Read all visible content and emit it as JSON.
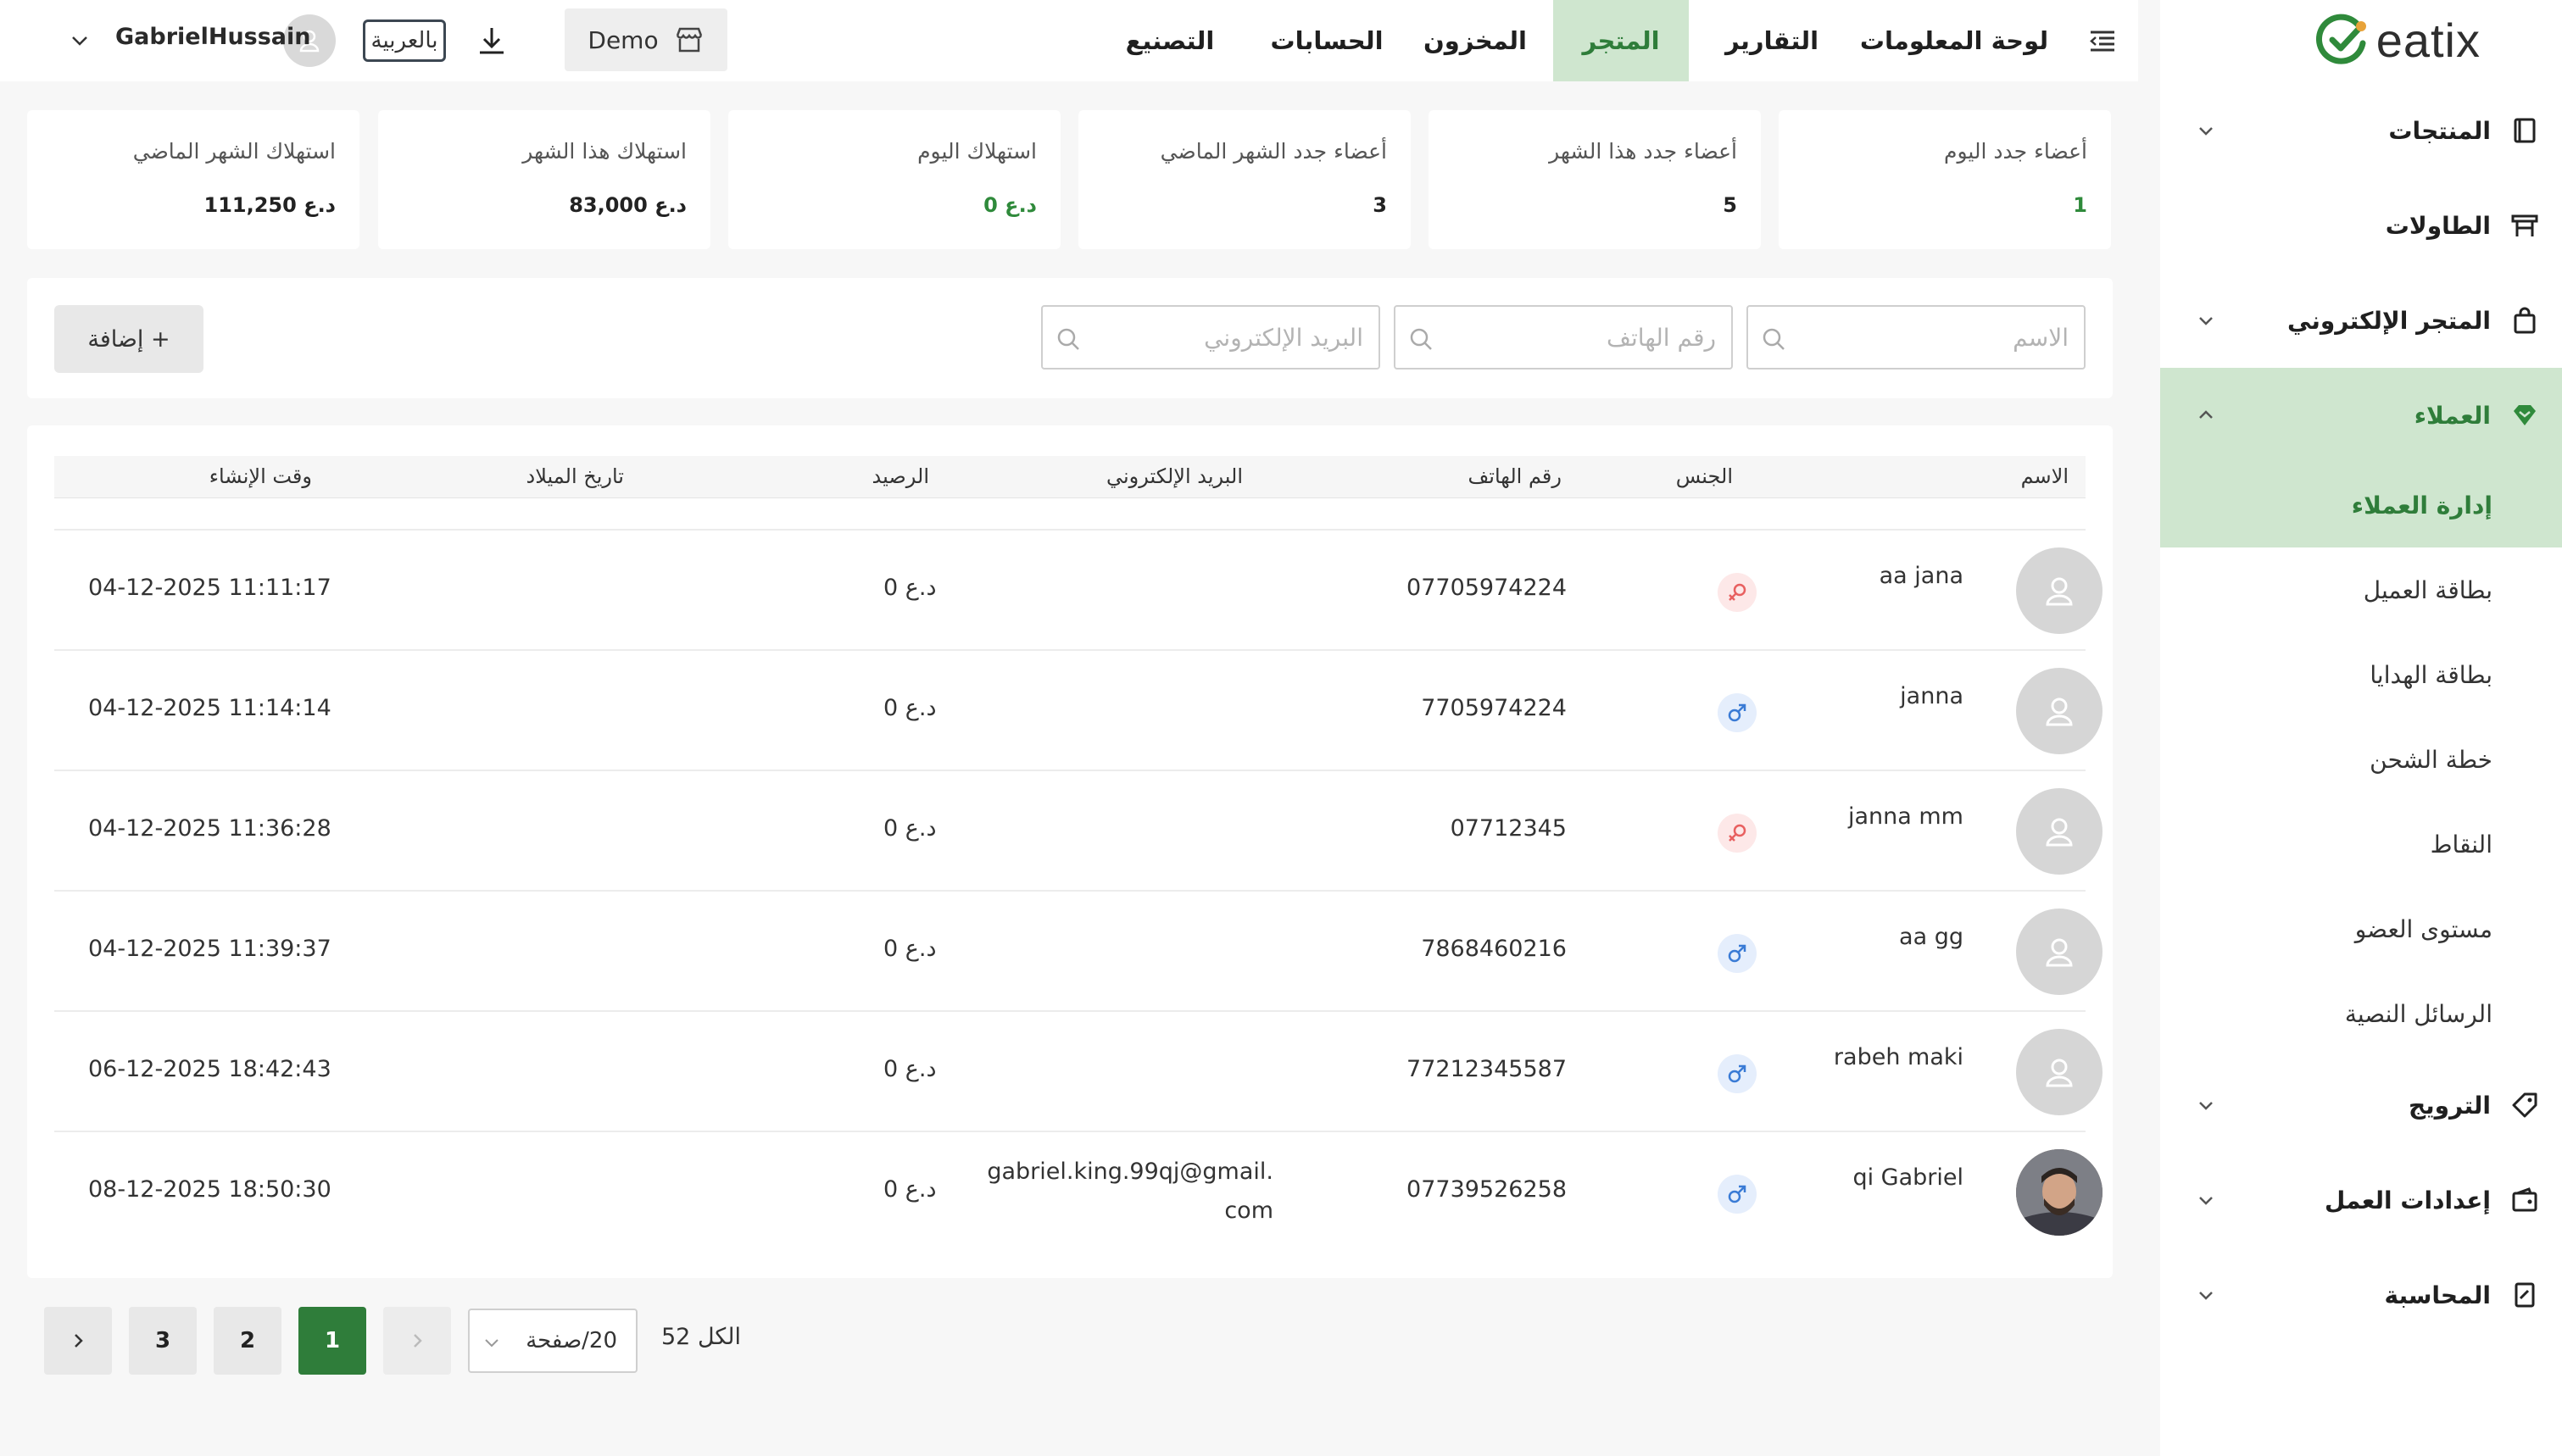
{
  "app": {
    "brand": "eatix"
  },
  "sidebar": {
    "items": [
      {
        "label": "المنتجات",
        "icon": "book-icon"
      },
      {
        "label": "الطاولات",
        "icon": "table-icon"
      },
      {
        "label": "المتجر الإلكتروني",
        "icon": "shopping-bag-icon"
      },
      {
        "label": "العملاء",
        "icon": "diamond-icon"
      },
      {
        "label": "الترويج",
        "icon": "tag-icon"
      },
      {
        "label": "إعدادات العمل",
        "icon": "wallet-icon"
      },
      {
        "label": "المحاسبة",
        "icon": "file-ledger-icon"
      }
    ],
    "sub_items": [
      {
        "label": "إدارة العملاء"
      },
      {
        "label": "بطاقة العميل"
      },
      {
        "label": "بطاقة الهدايا"
      },
      {
        "label": "خطة الشحن"
      },
      {
        "label": "النقاط"
      },
      {
        "label": "مستوى العضو"
      },
      {
        "label": "الرسائل النصية"
      }
    ]
  },
  "topnav": {
    "tabs": [
      {
        "label": "لوحة المعلومات"
      },
      {
        "label": "التقارير"
      },
      {
        "label": "المتجر"
      },
      {
        "label": "المخزون"
      },
      {
        "label": "الحسابات"
      },
      {
        "label": "التصنيع"
      }
    ],
    "demo_label": "Demo",
    "language_label": "بالعربية",
    "username": "GabrielHussain"
  },
  "stats": [
    {
      "title": "أعضاء جدد اليوم",
      "value": "1"
    },
    {
      "title": "أعضاء جدد هذا الشهر",
      "value": "5"
    },
    {
      "title": "أعضاء جدد الشهر الماضي",
      "value": "3"
    },
    {
      "title": "استهلاك اليوم",
      "value": "د.ع 0"
    },
    {
      "title": "استهلاك هذا الشهر",
      "value": "د.ع 83,000"
    },
    {
      "title": "استهلاك الشهر الماضي",
      "value": "د.ع 111,250"
    }
  ],
  "filters": {
    "name_placeholder": "الاسم",
    "phone_placeholder": "رقم الهاتف",
    "email_placeholder": "البريد الإلكتروني",
    "add_label": "+ إضافة"
  },
  "table": {
    "headers": {
      "name": "الاسم",
      "gender": "الجنس",
      "phone": "رقم الهاتف",
      "email": "البريد الإلكتروني",
      "balance": "الرصيد",
      "birthday": "تاريخ الميلاد",
      "created": "وقت الإنشاء"
    },
    "rows": [
      {
        "name": "aa jana",
        "gender": "female",
        "phone": "07705974224",
        "email": "",
        "balance": "د.ع 0",
        "birthday": "",
        "created": "04-12-2025 11:11:17",
        "avatar": "placeholder"
      },
      {
        "name": "janna",
        "gender": "male",
        "phone": "7705974224",
        "email": "",
        "balance": "د.ع 0",
        "birthday": "",
        "created": "04-12-2025 11:14:14",
        "avatar": "placeholder"
      },
      {
        "name": "janna mm",
        "gender": "female",
        "phone": "07712345",
        "email": "",
        "balance": "د.ع 0",
        "birthday": "",
        "created": "04-12-2025 11:36:28",
        "avatar": "placeholder"
      },
      {
        "name": "aa gg",
        "gender": "male",
        "phone": "7868460216",
        "email": "",
        "balance": "د.ع 0",
        "birthday": "",
        "created": "04-12-2025 11:39:37",
        "avatar": "placeholder"
      },
      {
        "name": "rabeh maki",
        "gender": "male",
        "phone": "77212345587",
        "email": "",
        "balance": "د.ع 0",
        "birthday": "",
        "created": "06-12-2025 18:42:43",
        "avatar": "placeholder"
      },
      {
        "name": "qi Gabriel",
        "gender": "male",
        "phone": "07739526258",
        "email": "gabriel.king.99qj@gmail.com",
        "balance": "د.ع 0",
        "birthday": "",
        "created": "08-12-2025 18:50:30",
        "avatar": "photo"
      }
    ]
  },
  "pagination": {
    "total_label": "الكل 52",
    "page_size_label": "20/صفحة",
    "pages": [
      "1",
      "2",
      "3"
    ],
    "current": "1"
  },
  "colors": {
    "accent": "#2f7d3a",
    "accent_light": "#cfe6cf",
    "female": "#e86060",
    "male": "#3a7bd5"
  }
}
